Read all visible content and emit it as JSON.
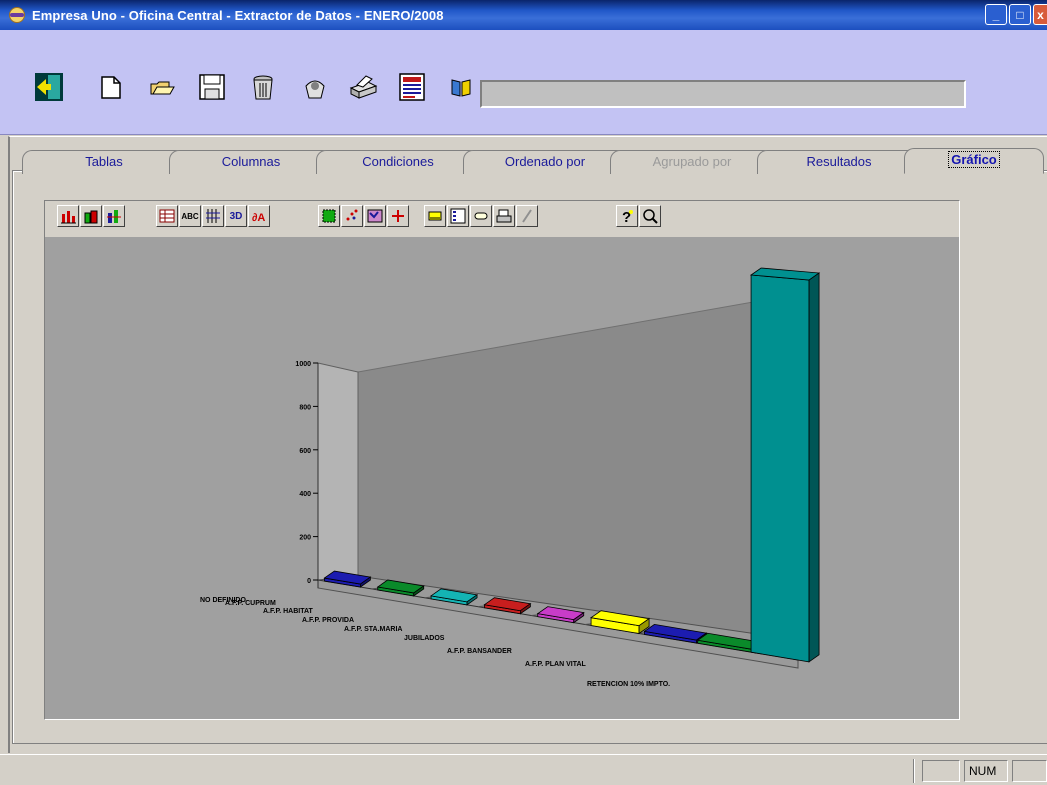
{
  "window": {
    "title": "Empresa Uno - Oficina Central - Extractor de Datos - ENERO/2008",
    "buttons": [
      "_",
      "□",
      "x"
    ]
  },
  "toolbar": {
    "icons": [
      "exit-icon",
      "new-document-icon",
      "open-folder-icon",
      "save-disk-icon",
      "trash-icon",
      "execute-icon",
      "printer-icon",
      "report-icon",
      "book-icon"
    ],
    "status_value": ""
  },
  "tabs": [
    {
      "label": "Tablas",
      "state": "normal"
    },
    {
      "label": "Columnas",
      "state": "normal"
    },
    {
      "label": "Condiciones",
      "state": "normal"
    },
    {
      "label": "Ordenado por",
      "state": "normal"
    },
    {
      "label": "Agrupado por",
      "state": "disabled"
    },
    {
      "label": "Resultados",
      "state": "normal"
    },
    {
      "label": "Gráfico",
      "state": "active"
    }
  ],
  "chart_toolbar": {
    "icons": [
      "bar-chart-icon",
      "area-3d-icon",
      "stacked-bar-icon",
      "data-grid-icon",
      "abc-labels-icon",
      "gridlines-icon",
      "3d-toggle-icon",
      "rotate-icon",
      "color-fill-icon",
      "scatter-icon",
      "legend-icon",
      "crosshair-icon",
      "title-icon",
      "series-legend-icon",
      "label-tag-icon",
      "print-icon",
      "pen-icon",
      "help-icon",
      "zoom-icon"
    ],
    "labels": {
      "abc": "ABC",
      "three_d": "3D"
    }
  },
  "chart_data": {
    "type": "bar",
    "style": "3d",
    "categories": [
      "NO DEFINIDO",
      "A.F.P. CUPRUM",
      "A.F.P. HABITAT",
      "A.F.P. PROVIDA",
      "A.F.P. STA.MARIA",
      "JUBILADOS",
      "A.F.P. BANSANDER",
      "A.F.P. PLAN VITAL",
      "RETENCION 10% IMPTO."
    ],
    "values": [
      5,
      5,
      5,
      5,
      5,
      80,
      20,
      25,
      2600
    ],
    "colors": [
      "#1c1cb0",
      "#0a8a2a",
      "#14b4b4",
      "#c81e1e",
      "#c83cc8",
      "#ffff00",
      "#1c1cb0",
      "#0a8a2a",
      "#009090"
    ],
    "y_ticks": [
      "0",
      "200",
      "400",
      "600",
      "800",
      "1000"
    ],
    "ylim": [
      0,
      1000
    ],
    "title": "",
    "xlabel": "",
    "ylabel": ""
  },
  "statusbar": {
    "num_label": "NUM"
  }
}
